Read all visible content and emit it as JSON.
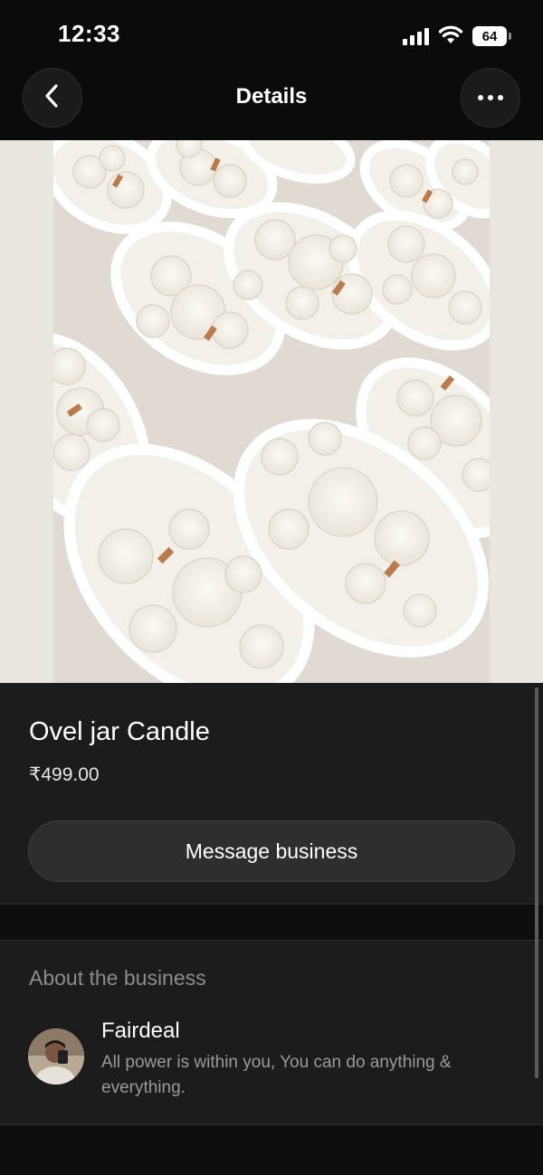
{
  "status_bar": {
    "time": "12:33",
    "battery": "64",
    "icons": [
      "signal-icon",
      "wifi-icon",
      "battery-icon"
    ]
  },
  "nav": {
    "title": "Details",
    "back_icon": "chevron-left-icon",
    "more_icon": "more-horizontal-icon"
  },
  "product": {
    "image_icon": "product-photo",
    "title": "Ovel jar Candle",
    "price": "₹499.00",
    "message_button": "Message business"
  },
  "about": {
    "heading": "About the business",
    "business_name": "Fairdeal",
    "description": "All power is within you, You can do anything & everything."
  },
  "colors": {
    "background": "#0b0b0b",
    "panel": "#1c1c1c",
    "button": "#2e2e2e",
    "muted_text": "#8c8c8c",
    "candle": "#f7f4ee"
  }
}
